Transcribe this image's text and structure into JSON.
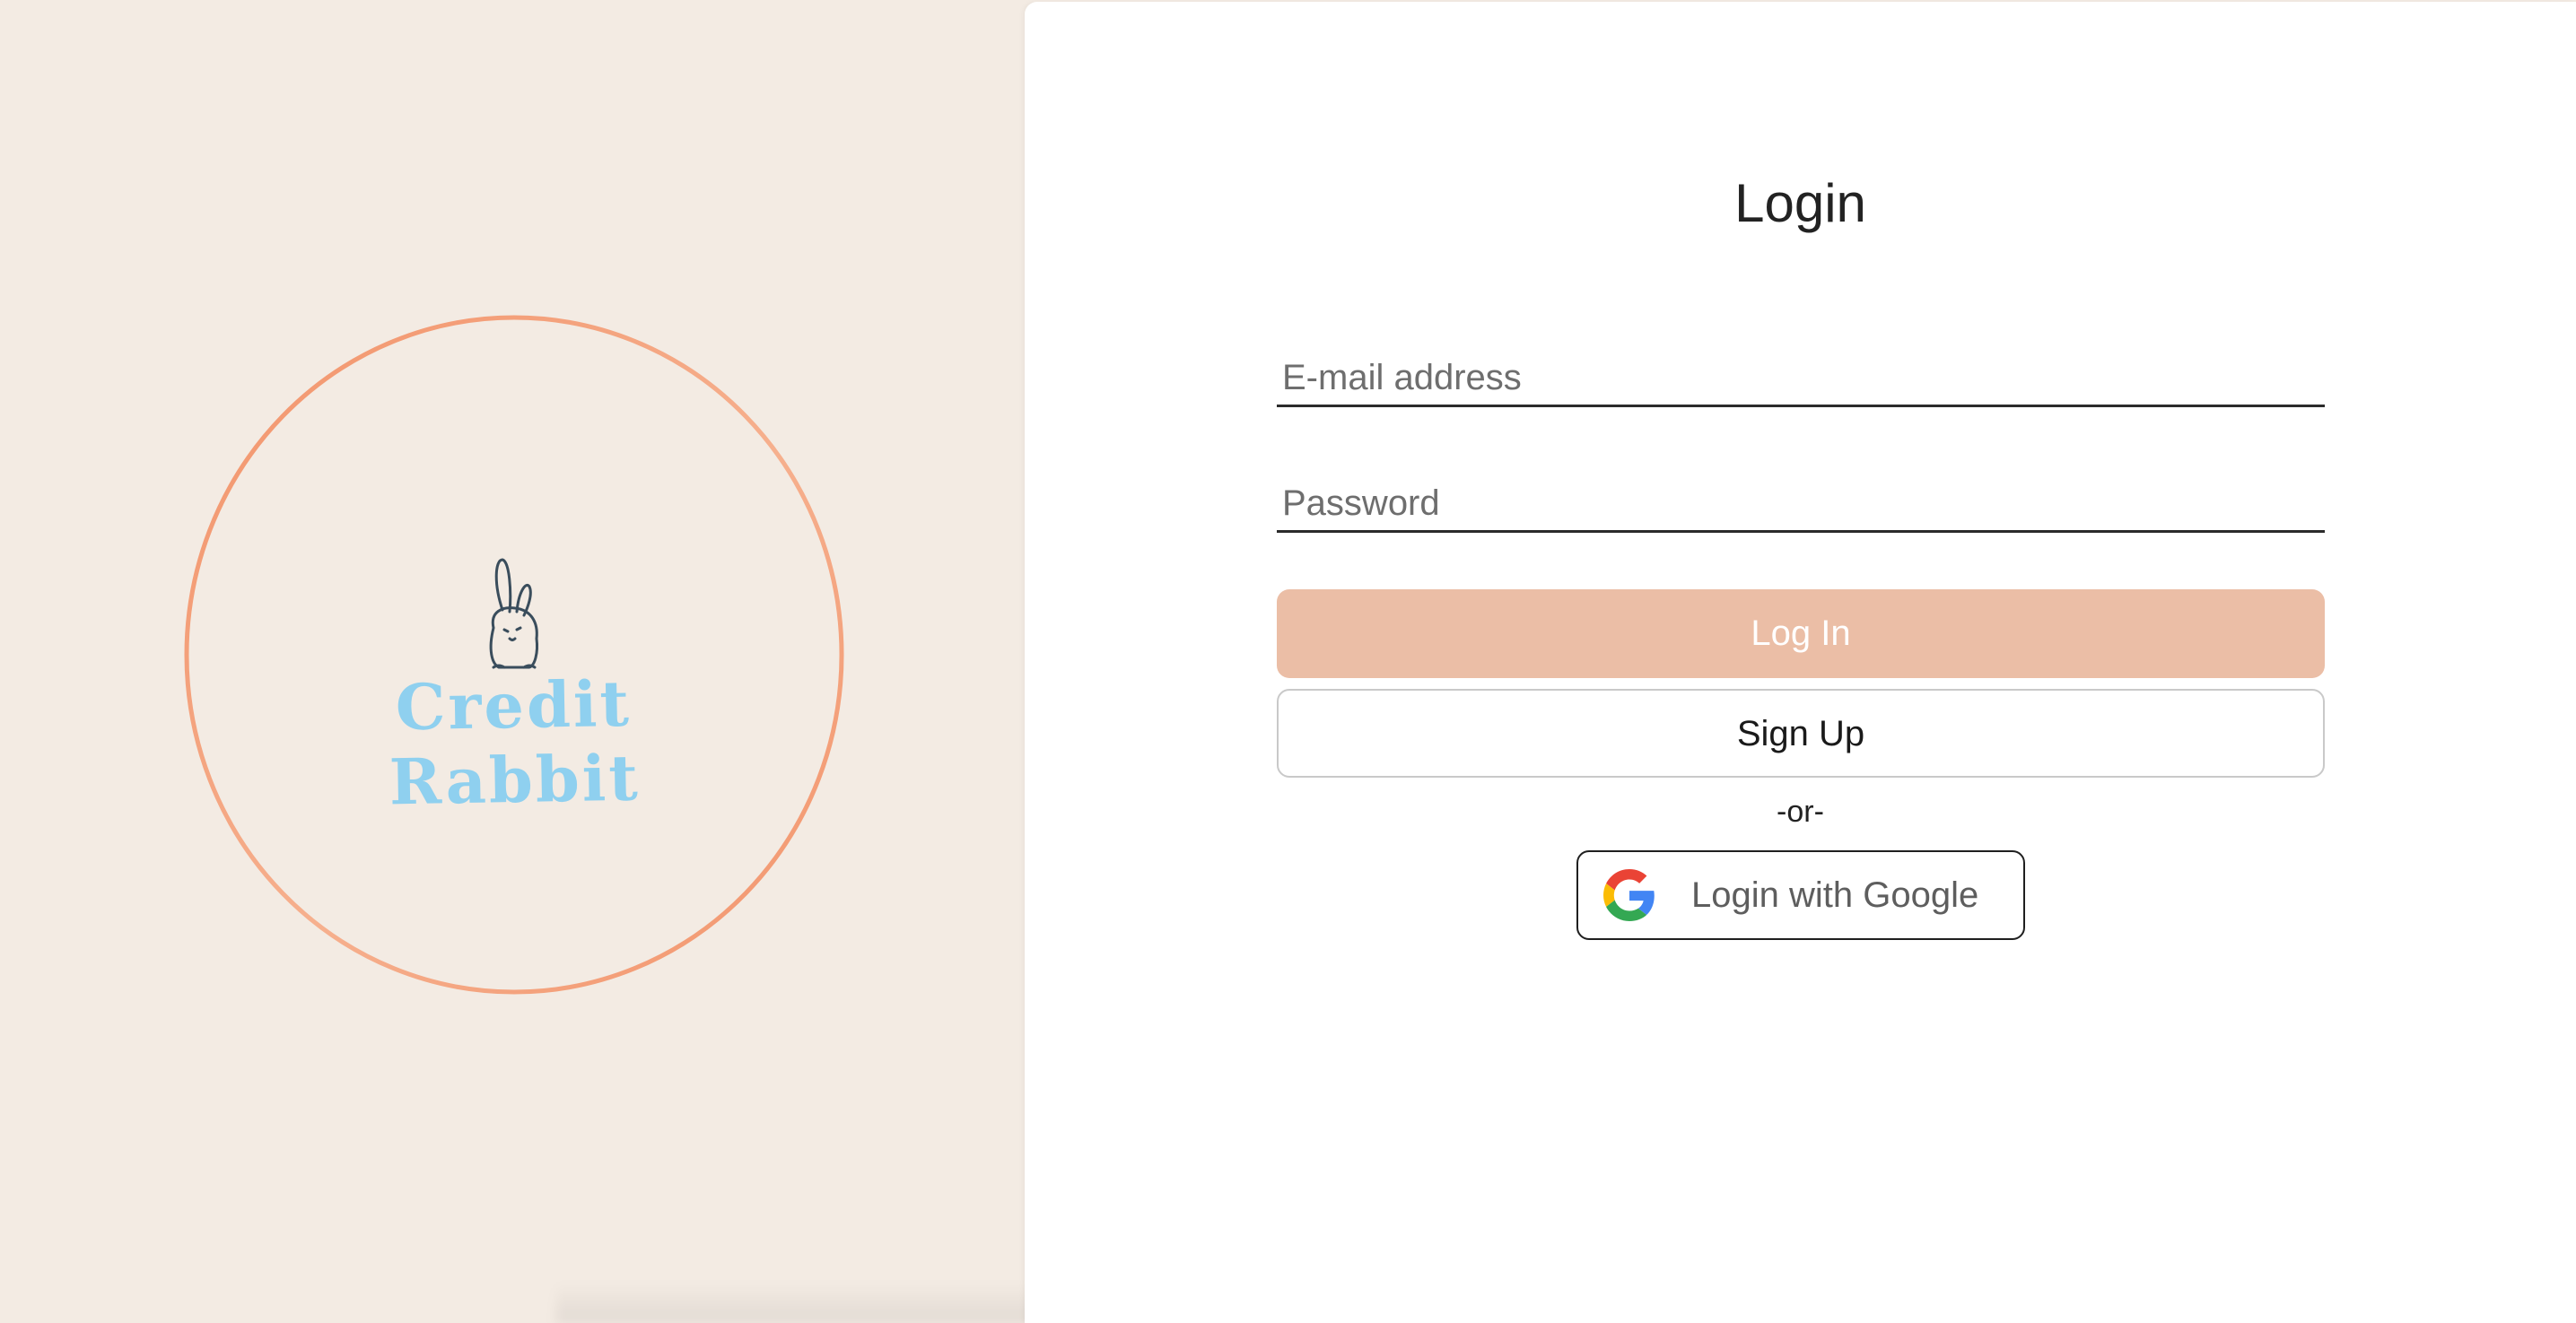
{
  "brand": {
    "name": "Credit Rabbit",
    "logo_icon": "rabbit-icon",
    "ring_color": "#f2936a",
    "name_color": "#8fd0ef",
    "background": "#f3ebe3"
  },
  "login": {
    "title": "Login",
    "email": {
      "placeholder": "E-mail address",
      "value": ""
    },
    "password": {
      "placeholder": "Password",
      "value": ""
    },
    "login_button": "Log In",
    "signup_button": "Sign Up",
    "divider": "-or-",
    "google_button": "Login with Google",
    "google_icon": "google-icon",
    "accent_color": "#ebbea6"
  }
}
